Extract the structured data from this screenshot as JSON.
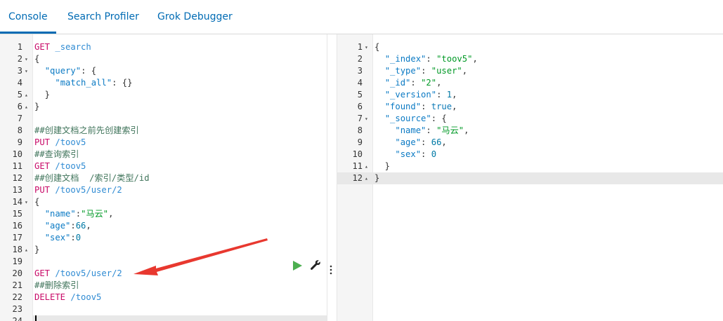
{
  "tabs": [
    {
      "label": "Console",
      "active": true
    },
    {
      "label": "Search Profiler",
      "active": false
    },
    {
      "label": "Grok Debugger",
      "active": false
    }
  ],
  "request_lines": [
    {
      "n": "1",
      "fold": "",
      "parts": [
        [
          "GET ",
          "method"
        ],
        [
          "_search",
          "url"
        ]
      ]
    },
    {
      "n": "2",
      "fold": "▾",
      "parts": [
        [
          "{",
          "brace"
        ]
      ]
    },
    {
      "n": "3",
      "fold": "▾",
      "parts": [
        [
          "  ",
          "plain"
        ],
        [
          "\"query\"",
          "key"
        ],
        [
          ": {",
          "brace"
        ]
      ]
    },
    {
      "n": "4",
      "fold": "",
      "parts": [
        [
          "    ",
          "plain"
        ],
        [
          "\"match_all\"",
          "key"
        ],
        [
          ": {}",
          "brace"
        ]
      ]
    },
    {
      "n": "5",
      "fold": "▴",
      "parts": [
        [
          "  }",
          "brace"
        ]
      ]
    },
    {
      "n": "6",
      "fold": "▴",
      "parts": [
        [
          "}",
          "brace"
        ]
      ]
    },
    {
      "n": "7",
      "fold": "",
      "parts": []
    },
    {
      "n": "8",
      "fold": "",
      "parts": [
        [
          "##创建文档之前先创建索引",
          "comment"
        ]
      ]
    },
    {
      "n": "9",
      "fold": "",
      "parts": [
        [
          "PUT ",
          "method"
        ],
        [
          "/toov5",
          "url"
        ]
      ]
    },
    {
      "n": "10",
      "fold": "",
      "parts": [
        [
          "##查询索引",
          "comment"
        ]
      ]
    },
    {
      "n": "11",
      "fold": "",
      "parts": [
        [
          "GET ",
          "method"
        ],
        [
          "/toov5",
          "url"
        ]
      ]
    },
    {
      "n": "12",
      "fold": "",
      "parts": [
        [
          "##创建文档  /索引/类型/id",
          "comment"
        ]
      ]
    },
    {
      "n": "13",
      "fold": "",
      "parts": [
        [
          "PUT ",
          "method"
        ],
        [
          "/toov5/user/2",
          "url"
        ]
      ]
    },
    {
      "n": "14",
      "fold": "▾",
      "parts": [
        [
          "{",
          "brace"
        ]
      ]
    },
    {
      "n": "15",
      "fold": "",
      "parts": [
        [
          "  ",
          "plain"
        ],
        [
          "\"name\"",
          "key"
        ],
        [
          ":",
          "brace"
        ],
        [
          "\"马云\"",
          "str"
        ],
        [
          ",",
          "brace"
        ]
      ]
    },
    {
      "n": "16",
      "fold": "",
      "parts": [
        [
          "  ",
          "plain"
        ],
        [
          "\"age\"",
          "key"
        ],
        [
          ":",
          "brace"
        ],
        [
          "66",
          "num"
        ],
        [
          ",",
          "brace"
        ]
      ]
    },
    {
      "n": "17",
      "fold": "",
      "parts": [
        [
          "  ",
          "plain"
        ],
        [
          "\"sex\"",
          "key"
        ],
        [
          ":",
          "brace"
        ],
        [
          "0",
          "num"
        ]
      ]
    },
    {
      "n": "18",
      "fold": "▴",
      "parts": [
        [
          "}",
          "brace"
        ]
      ]
    },
    {
      "n": "19",
      "fold": "",
      "parts": []
    },
    {
      "n": "20",
      "fold": "",
      "parts": [
        [
          "GET ",
          "method"
        ],
        [
          "/toov5/user/2",
          "url"
        ]
      ]
    },
    {
      "n": "21",
      "fold": "",
      "parts": [
        [
          "##删除索引",
          "comment"
        ]
      ]
    },
    {
      "n": "22",
      "fold": "",
      "parts": [
        [
          "DELETE ",
          "method"
        ],
        [
          "/toov5",
          "url"
        ]
      ]
    },
    {
      "n": "23",
      "fold": "",
      "parts": []
    },
    {
      "n": "24",
      "fold": "",
      "parts": []
    }
  ],
  "response_lines": [
    {
      "n": "1",
      "fold": "▾",
      "parts": [
        [
          "{",
          "brace"
        ]
      ]
    },
    {
      "n": "2",
      "fold": "",
      "parts": [
        [
          "  ",
          "plain"
        ],
        [
          "\"_index\"",
          "key"
        ],
        [
          ": ",
          "brace"
        ],
        [
          "\"toov5\"",
          "str"
        ],
        [
          ",",
          "brace"
        ]
      ]
    },
    {
      "n": "3",
      "fold": "",
      "parts": [
        [
          "  ",
          "plain"
        ],
        [
          "\"_type\"",
          "key"
        ],
        [
          ": ",
          "brace"
        ],
        [
          "\"user\"",
          "str"
        ],
        [
          ",",
          "brace"
        ]
      ]
    },
    {
      "n": "4",
      "fold": "",
      "parts": [
        [
          "  ",
          "plain"
        ],
        [
          "\"_id\"",
          "key"
        ],
        [
          ": ",
          "brace"
        ],
        [
          "\"2\"",
          "str"
        ],
        [
          ",",
          "brace"
        ]
      ]
    },
    {
      "n": "5",
      "fold": "",
      "parts": [
        [
          "  ",
          "plain"
        ],
        [
          "\"_version\"",
          "key"
        ],
        [
          ": ",
          "brace"
        ],
        [
          "1",
          "num"
        ],
        [
          ",",
          "brace"
        ]
      ]
    },
    {
      "n": "6",
      "fold": "",
      "parts": [
        [
          "  ",
          "plain"
        ],
        [
          "\"found\"",
          "key"
        ],
        [
          ": ",
          "brace"
        ],
        [
          "true",
          "bool"
        ],
        [
          ",",
          "brace"
        ]
      ]
    },
    {
      "n": "7",
      "fold": "▾",
      "parts": [
        [
          "  ",
          "plain"
        ],
        [
          "\"_source\"",
          "key"
        ],
        [
          ": {",
          "brace"
        ]
      ]
    },
    {
      "n": "8",
      "fold": "",
      "parts": [
        [
          "    ",
          "plain"
        ],
        [
          "\"name\"",
          "key"
        ],
        [
          ": ",
          "brace"
        ],
        [
          "\"马云\"",
          "str"
        ],
        [
          ",",
          "brace"
        ]
      ]
    },
    {
      "n": "9",
      "fold": "",
      "parts": [
        [
          "    ",
          "plain"
        ],
        [
          "\"age\"",
          "key"
        ],
        [
          ": ",
          "brace"
        ],
        [
          "66",
          "num"
        ],
        [
          ",",
          "brace"
        ]
      ]
    },
    {
      "n": "10",
      "fold": "",
      "parts": [
        [
          "    ",
          "plain"
        ],
        [
          "\"sex\"",
          "key"
        ],
        [
          ": ",
          "brace"
        ],
        [
          "0",
          "num"
        ]
      ]
    },
    {
      "n": "11",
      "fold": "▴",
      "parts": [
        [
          "  }",
          "brace"
        ]
      ]
    },
    {
      "n": "12",
      "fold": "▴",
      "parts": [
        [
          "}",
          "brace"
        ]
      ]
    }
  ],
  "icons": {
    "run": "play-icon",
    "settings": "wrench-icon",
    "more": "vertical-dots-icon"
  },
  "colors": {
    "accent": "#006bb4",
    "method": "#c80a68",
    "url": "#2f8bd3",
    "string": "#009926",
    "arrow": "#e8382f",
    "run": "#4caf50"
  }
}
